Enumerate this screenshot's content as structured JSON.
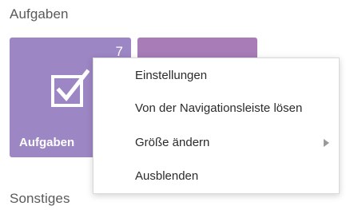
{
  "sections": {
    "first_heading": "Aufgaben",
    "second_heading": "Sonstiges"
  },
  "tiles": [
    {
      "label": "Aufgaben",
      "badge": "7",
      "icon": "checkbox-checked-icon",
      "color": "#9d86c4"
    },
    {
      "label": "",
      "badge": "",
      "color": "#a77cb7"
    }
  ],
  "context_menu": {
    "items": [
      {
        "label": "Einstellungen",
        "has_submenu": false
      },
      {
        "label": "Von der Navigationsleiste lösen",
        "has_submenu": false
      },
      {
        "label": "Größe ändern",
        "has_submenu": true,
        "submenu_icon": "chevron-right-icon"
      },
      {
        "label": "Ausblenden",
        "has_submenu": false
      }
    ]
  }
}
